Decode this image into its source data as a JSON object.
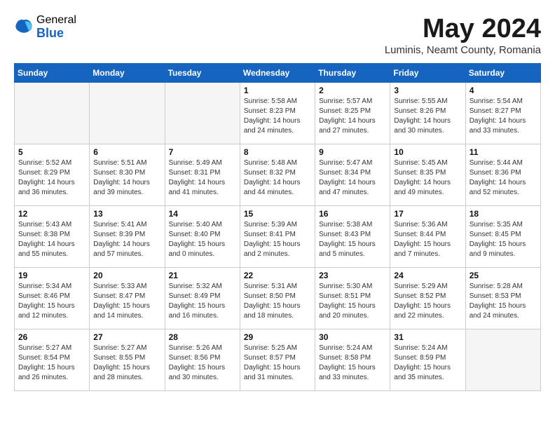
{
  "logo": {
    "general": "General",
    "blue": "Blue"
  },
  "title": "May 2024",
  "subtitle": "Luminis, Neamt County, Romania",
  "days_of_week": [
    "Sunday",
    "Monday",
    "Tuesday",
    "Wednesday",
    "Thursday",
    "Friday",
    "Saturday"
  ],
  "weeks": [
    [
      {
        "day": "",
        "info": ""
      },
      {
        "day": "",
        "info": ""
      },
      {
        "day": "",
        "info": ""
      },
      {
        "day": "1",
        "info": "Sunrise: 5:58 AM\nSunset: 8:23 PM\nDaylight: 14 hours\nand 24 minutes."
      },
      {
        "day": "2",
        "info": "Sunrise: 5:57 AM\nSunset: 8:25 PM\nDaylight: 14 hours\nand 27 minutes."
      },
      {
        "day": "3",
        "info": "Sunrise: 5:55 AM\nSunset: 8:26 PM\nDaylight: 14 hours\nand 30 minutes."
      },
      {
        "day": "4",
        "info": "Sunrise: 5:54 AM\nSunset: 8:27 PM\nDaylight: 14 hours\nand 33 minutes."
      }
    ],
    [
      {
        "day": "5",
        "info": "Sunrise: 5:52 AM\nSunset: 8:29 PM\nDaylight: 14 hours\nand 36 minutes."
      },
      {
        "day": "6",
        "info": "Sunrise: 5:51 AM\nSunset: 8:30 PM\nDaylight: 14 hours\nand 39 minutes."
      },
      {
        "day": "7",
        "info": "Sunrise: 5:49 AM\nSunset: 8:31 PM\nDaylight: 14 hours\nand 41 minutes."
      },
      {
        "day": "8",
        "info": "Sunrise: 5:48 AM\nSunset: 8:32 PM\nDaylight: 14 hours\nand 44 minutes."
      },
      {
        "day": "9",
        "info": "Sunrise: 5:47 AM\nSunset: 8:34 PM\nDaylight: 14 hours\nand 47 minutes."
      },
      {
        "day": "10",
        "info": "Sunrise: 5:45 AM\nSunset: 8:35 PM\nDaylight: 14 hours\nand 49 minutes."
      },
      {
        "day": "11",
        "info": "Sunrise: 5:44 AM\nSunset: 8:36 PM\nDaylight: 14 hours\nand 52 minutes."
      }
    ],
    [
      {
        "day": "12",
        "info": "Sunrise: 5:43 AM\nSunset: 8:38 PM\nDaylight: 14 hours\nand 55 minutes."
      },
      {
        "day": "13",
        "info": "Sunrise: 5:41 AM\nSunset: 8:39 PM\nDaylight: 14 hours\nand 57 minutes."
      },
      {
        "day": "14",
        "info": "Sunrise: 5:40 AM\nSunset: 8:40 PM\nDaylight: 15 hours\nand 0 minutes."
      },
      {
        "day": "15",
        "info": "Sunrise: 5:39 AM\nSunset: 8:41 PM\nDaylight: 15 hours\nand 2 minutes."
      },
      {
        "day": "16",
        "info": "Sunrise: 5:38 AM\nSunset: 8:43 PM\nDaylight: 15 hours\nand 5 minutes."
      },
      {
        "day": "17",
        "info": "Sunrise: 5:36 AM\nSunset: 8:44 PM\nDaylight: 15 hours\nand 7 minutes."
      },
      {
        "day": "18",
        "info": "Sunrise: 5:35 AM\nSunset: 8:45 PM\nDaylight: 15 hours\nand 9 minutes."
      }
    ],
    [
      {
        "day": "19",
        "info": "Sunrise: 5:34 AM\nSunset: 8:46 PM\nDaylight: 15 hours\nand 12 minutes."
      },
      {
        "day": "20",
        "info": "Sunrise: 5:33 AM\nSunset: 8:47 PM\nDaylight: 15 hours\nand 14 minutes."
      },
      {
        "day": "21",
        "info": "Sunrise: 5:32 AM\nSunset: 8:49 PM\nDaylight: 15 hours\nand 16 minutes."
      },
      {
        "day": "22",
        "info": "Sunrise: 5:31 AM\nSunset: 8:50 PM\nDaylight: 15 hours\nand 18 minutes."
      },
      {
        "day": "23",
        "info": "Sunrise: 5:30 AM\nSunset: 8:51 PM\nDaylight: 15 hours\nand 20 minutes."
      },
      {
        "day": "24",
        "info": "Sunrise: 5:29 AM\nSunset: 8:52 PM\nDaylight: 15 hours\nand 22 minutes."
      },
      {
        "day": "25",
        "info": "Sunrise: 5:28 AM\nSunset: 8:53 PM\nDaylight: 15 hours\nand 24 minutes."
      }
    ],
    [
      {
        "day": "26",
        "info": "Sunrise: 5:27 AM\nSunset: 8:54 PM\nDaylight: 15 hours\nand 26 minutes."
      },
      {
        "day": "27",
        "info": "Sunrise: 5:27 AM\nSunset: 8:55 PM\nDaylight: 15 hours\nand 28 minutes."
      },
      {
        "day": "28",
        "info": "Sunrise: 5:26 AM\nSunset: 8:56 PM\nDaylight: 15 hours\nand 30 minutes."
      },
      {
        "day": "29",
        "info": "Sunrise: 5:25 AM\nSunset: 8:57 PM\nDaylight: 15 hours\nand 31 minutes."
      },
      {
        "day": "30",
        "info": "Sunrise: 5:24 AM\nSunset: 8:58 PM\nDaylight: 15 hours\nand 33 minutes."
      },
      {
        "day": "31",
        "info": "Sunrise: 5:24 AM\nSunset: 8:59 PM\nDaylight: 15 hours\nand 35 minutes."
      },
      {
        "day": "",
        "info": ""
      }
    ]
  ]
}
